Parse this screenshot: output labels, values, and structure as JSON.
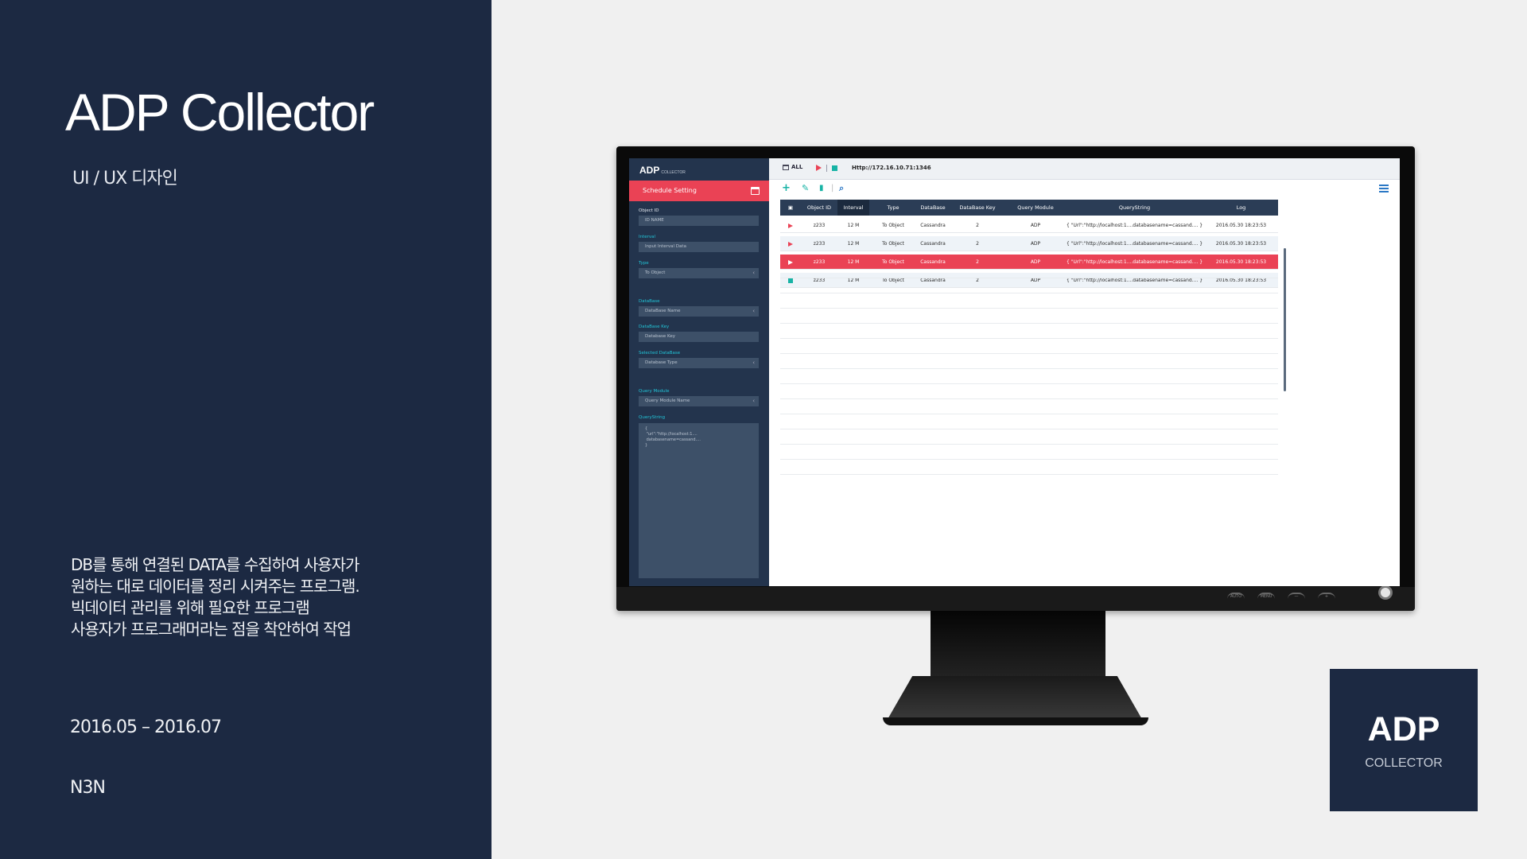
{
  "left": {
    "title": "ADP Collector",
    "subtitle": "UI / UX 디자인",
    "description": [
      "DB를 통해 연결된 DATA를 수집하여 사용자가",
      "원하는 대로 데이터를 정리 시켜주는 프로그램.",
      "빅데이터 관리를 위해 필요한 프로그램",
      "사용자가 프로그래머라는 점을 착안하여 작업"
    ],
    "period": "2016.05 – 2016.07",
    "company": "N3N"
  },
  "app": {
    "logo": "ADP",
    "logo_sub": "COLLECTOR",
    "schedule_title": "Schedule Setting",
    "form": [
      {
        "label": "Object ID",
        "value": "ID NAME",
        "select": false
      },
      {
        "label": "Interval",
        "value": "Input Interval Data",
        "select": false
      },
      {
        "label": "Type",
        "value": "To Object",
        "select": true
      },
      {
        "label": "DataBase",
        "value": "DataBase Name",
        "select": true
      },
      {
        "label": "DataBase Key",
        "value": "Database Key",
        "select": false
      },
      {
        "label": "Selected DataBase",
        "value": "Database Type",
        "select": true
      },
      {
        "label": "Query Module",
        "value": "Query Module Name",
        "select": true
      }
    ],
    "querystring_label": "QueryString",
    "querystring_value": "{\n \"url\":\"http://localhost:1....\n databasename=cassand....\n}",
    "topbar": {
      "all_label": "ALL",
      "url": "Http://172.16.10.71:1346"
    },
    "toolbar_icons": [
      "add-icon",
      "edit-icon",
      "delete-icon",
      "search-icon",
      "list-icon"
    ],
    "columns": [
      "Object ID",
      "Interval",
      "Type",
      "DataBase",
      "DataBase Key",
      "Query Module",
      "QueryString",
      "Log"
    ],
    "active_column": "Interval",
    "rows": [
      {
        "status": "play",
        "cells": [
          "z233",
          "12 M",
          "To Object",
          "Cassandra",
          "2",
          "ADP",
          "{ \"Url\":\"http://localhost:1....databasename=cassand.... }",
          "2016.05.30 18:23:53"
        ]
      },
      {
        "status": "play",
        "cells": [
          "z233",
          "12 M",
          "To Object",
          "Cassandra",
          "2",
          "ADP",
          "{ \"Url\":\"http://localhost:1....databasename=cassand.... }",
          "2016.05.30 18:23:53"
        ]
      },
      {
        "status": "play",
        "cells": [
          "z233",
          "12 M",
          "To Object",
          "Cassandra",
          "2",
          "ADP",
          "{ \"Url\":\"http://localhost:1....databasename=cassand.... }",
          "2016.05.30 18:23:53"
        ],
        "selected": true
      },
      {
        "status": "stop",
        "cells": [
          "z233",
          "12 M",
          "To Object",
          "Cassandra",
          "2",
          "ADP",
          "{ \"Url\":\"http://localhost:1....databasename=cassand.... }",
          "2016.05.30 18:23:53"
        ]
      }
    ]
  },
  "monitor_buttons": [
    "AUTO",
    "MENU",
    "—",
    "+"
  ],
  "card": {
    "title": "ADP",
    "subtitle": "COLLECTOR"
  },
  "colors": {
    "navy": "#1c2942",
    "accent_red": "#ea4255",
    "accent_teal": "#17b3a5"
  }
}
